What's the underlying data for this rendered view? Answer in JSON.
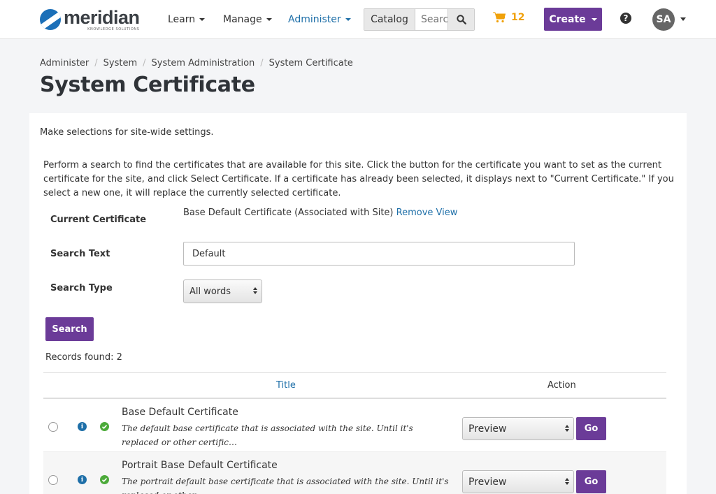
{
  "header": {
    "logo_text": "meridian",
    "logo_subtext": "KNOWLEDGE SOLUTIONS",
    "nav": {
      "learn": "Learn",
      "manage": "Manage",
      "administer": "Administer"
    },
    "catalog_label": "Catalog",
    "catalog_placeholder": "Search",
    "cart_count": "12",
    "create_label": "Create",
    "help_label": "?",
    "avatar_initials": "SA",
    "colors": {
      "accent_purple": "#6b3b98",
      "link_blue": "#1e6fa8",
      "cart_orange": "#f0a10a"
    }
  },
  "breadcrumb": [
    "Administer",
    "System",
    "System Administration",
    "System Certificate"
  ],
  "page_title": "System Certificate",
  "intro": "Make selections for site-wide settings.",
  "instructions": "Perform a search to find the certificates that are available for this site. Click the button for the certificate you want to set as the current certificate for the site, and click Select Certificate. If a certificate has already been selected, it displays next to \"Current Certificate.\" If you select a new one, it will replace the currently selected certificate.",
  "form": {
    "current_certificate_label": "Current Certificate",
    "current_certificate_value": "Base Default Certificate (Associated with Site)",
    "remove_link": "Remove",
    "view_link": "View",
    "search_text_label": "Search Text",
    "search_text_value": "Default",
    "search_type_label": "Search Type",
    "search_type_value": "All words",
    "search_button": "Search"
  },
  "records_found": "Records found: 2",
  "table": {
    "columns": {
      "title": "Title",
      "action": "Action"
    },
    "rows": [
      {
        "title": "Base Default Certificate",
        "description": "The default base certificate that is associated with the site. Until it's replaced or other certific…",
        "action_value": "Preview",
        "go_label": "Go"
      },
      {
        "title": "Portrait Base Default Certificate",
        "description": "The portrait default base certificate that is associated with the site. Until it's replaced or other…",
        "action_value": "Preview",
        "go_label": "Go"
      }
    ]
  }
}
